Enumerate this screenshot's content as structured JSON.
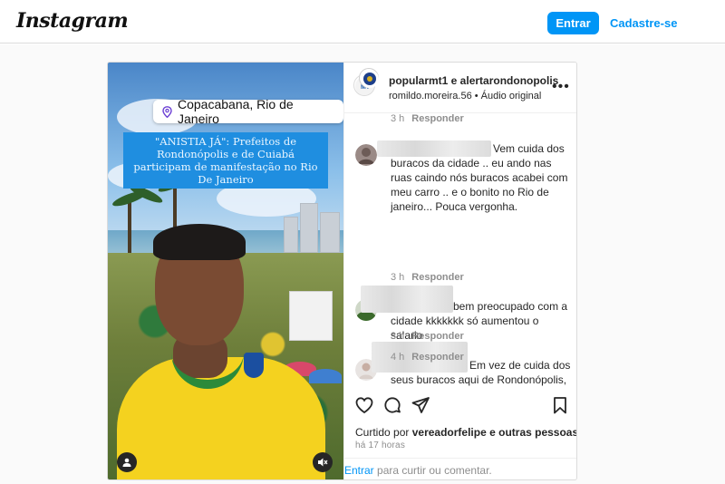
{
  "header": {
    "logo": "Instagram",
    "login_label": "Entrar",
    "signup_label": "Cadastre-se"
  },
  "media": {
    "location": "Copacabana, Rio de Janeiro",
    "caption": "\"ANISTIA JÁ\": Prefeitos de Rondonópolis e de Cuiabá participam de manifestação no Rio De Janeiro",
    "icons": [
      "location-pin-icon",
      "user-tag-icon",
      "mute-icon"
    ]
  },
  "post": {
    "account_title": "popularmt1 e alertarondonopolis",
    "account_sub": "romildo.moreira.56 • Áudio original",
    "more_label": "•••"
  },
  "comments": [
    {
      "meta_time": "3 h",
      "meta_reply": "Responder"
    },
    {
      "text": "Vem cuida dos buracos da cidade .. eu ando nas ruas caindo nós buracos acabei com meu carro .. e o bonito no Rio de janeiro... Pouca vergonha.",
      "text_first": "Vem cuida dos",
      "text_rest": "buracos da cidade .. eu ando nas ruas caindo nós buracos acabei com meu carro .. e o bonito no Rio de janeiro... Pouca vergonha.",
      "time": "3 h",
      "reply": "Responder"
    },
    {
      "text_first": "bem preocupado com a",
      "text_rest": "cidade kkkkkkk só aumentou o salario",
      "time": "3 h",
      "reply": "Responder"
    },
    {
      "text_first": "Em vez de cuida dos",
      "text_rest": "seus buracos aqui de Rondonópolis, esse prefeito ae tá passeando lamentável 😂😂😂😂😂",
      "time": "4 h",
      "reply": "Responder"
    }
  ],
  "footer": {
    "liked_prefix": "Curtido por",
    "liked_user": "vereadorfelipe",
    "liked_suffix": "e outras pessoas",
    "time": "há 17 horas",
    "login_link": "Entrar",
    "login_suffix": "para curtir ou comentar."
  },
  "colors": {
    "accent": "#0095f6",
    "caption_bg": "#1f8ee0",
    "shirt": "#f4d21f"
  }
}
